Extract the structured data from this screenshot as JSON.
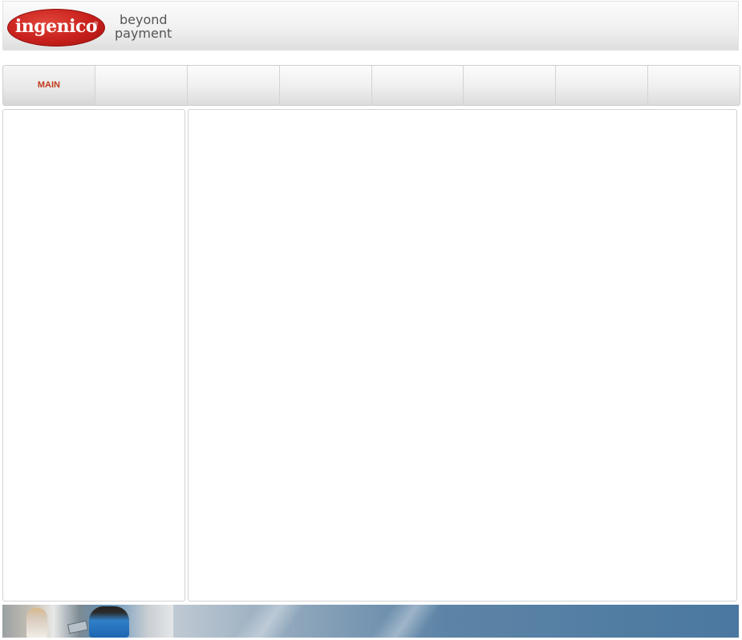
{
  "brand": {
    "logo_text": "ingenico",
    "registered_mark": "®",
    "tagline_line1": "beyond",
    "tagline_line2": "payment",
    "accent_color": "#c8201c"
  },
  "nav": {
    "tabs": [
      {
        "label": "MAIN",
        "active": true
      },
      {
        "label": "",
        "active": false
      },
      {
        "label": "",
        "active": false
      },
      {
        "label": "",
        "active": false
      },
      {
        "label": "",
        "active": false
      },
      {
        "label": "",
        "active": false
      },
      {
        "label": "",
        "active": false
      },
      {
        "label": "",
        "active": false
      }
    ],
    "active_text_color": "#c0391b"
  }
}
